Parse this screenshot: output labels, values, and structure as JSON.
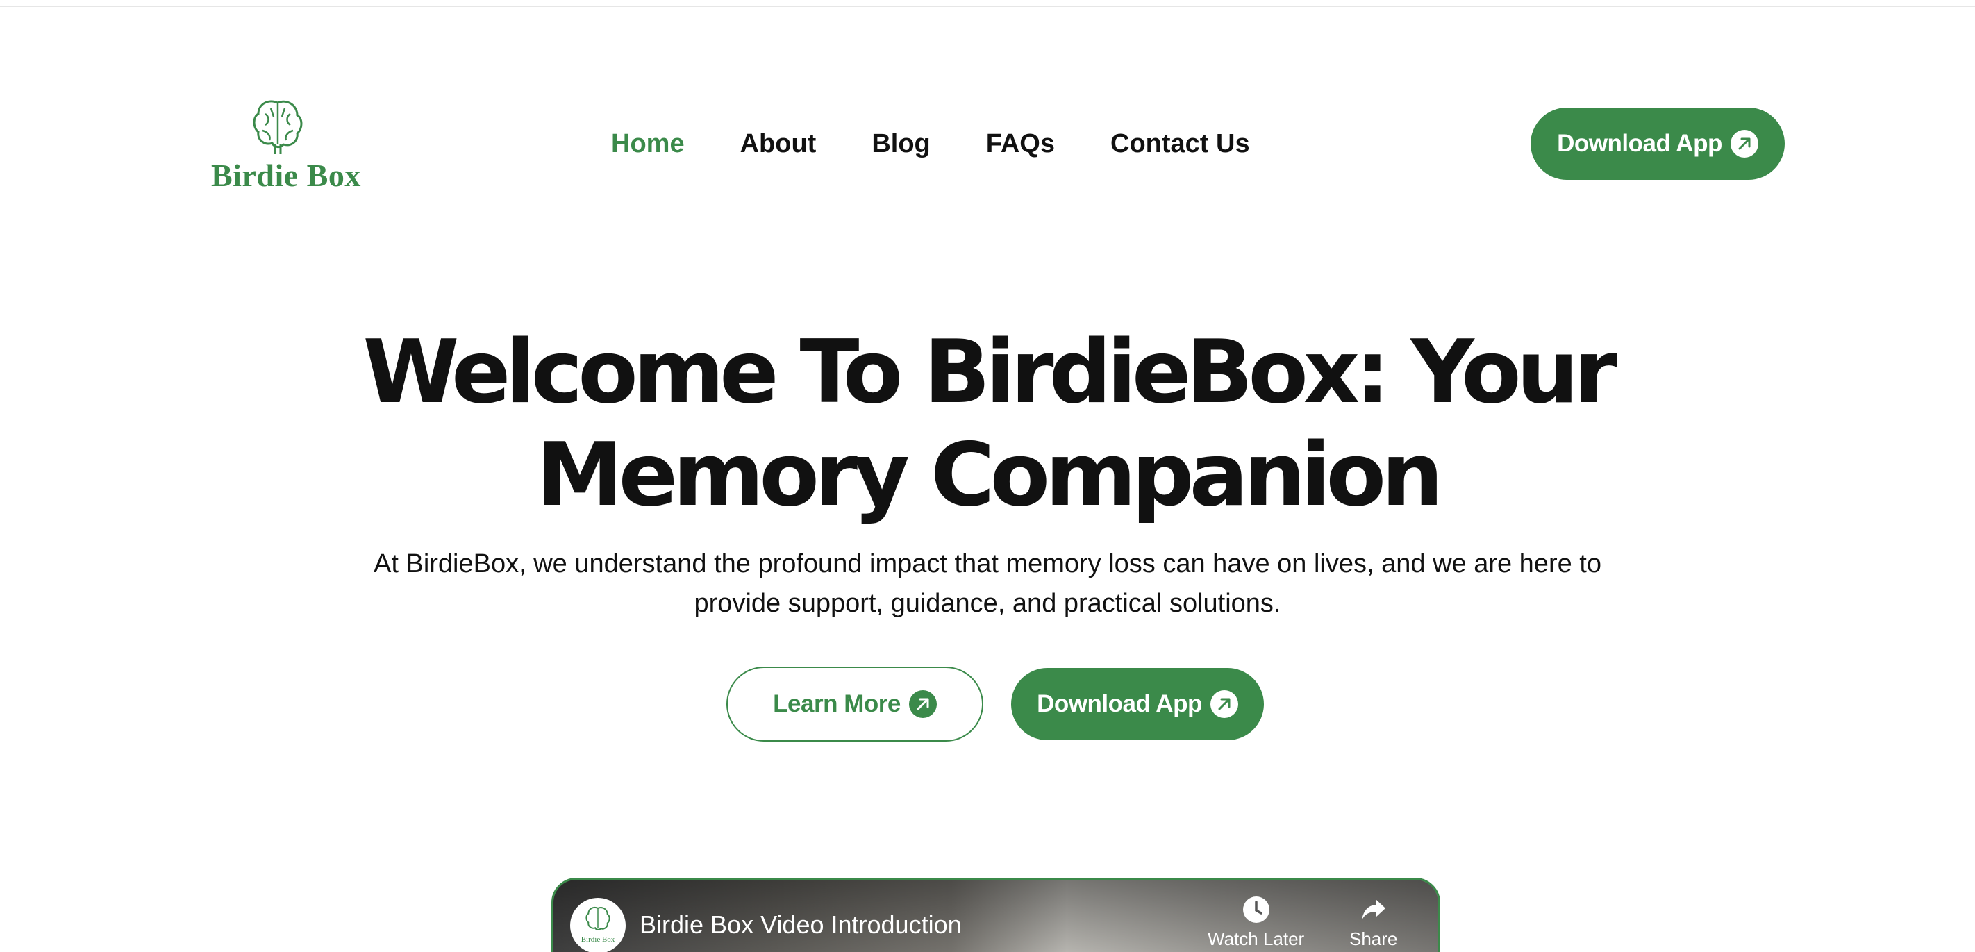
{
  "brand": {
    "logo_text": "Birdie Box",
    "accent_color": "#3b8a4a",
    "logo_icon": "brain-icon"
  },
  "nav": {
    "items": [
      {
        "label": "Home",
        "active": true
      },
      {
        "label": "About",
        "active": false
      },
      {
        "label": "Blog",
        "active": false
      },
      {
        "label": "FAQs",
        "active": false
      },
      {
        "label": "Contact Us",
        "active": false
      }
    ]
  },
  "header": {
    "cta_label": "Download App",
    "cta_icon": "arrow-up-right-icon"
  },
  "hero": {
    "title_line1": "Welcome To BirdieBox: Your",
    "title_line2": "Memory Companion",
    "subtitle_line1": "At BirdieBox, we understand the profound impact that memory loss can have on lives, and we are here to",
    "subtitle_line2": "provide support, guidance, and practical solutions.",
    "learn_more_label": "Learn More",
    "download_label": "Download App"
  },
  "video": {
    "title": "Birdie Box Video Introduction",
    "channel_logo_text": "Birdie Box",
    "watch_later_label": "Watch Later",
    "share_label": "Share",
    "watch_later_icon": "clock-icon",
    "share_icon": "share-icon"
  }
}
